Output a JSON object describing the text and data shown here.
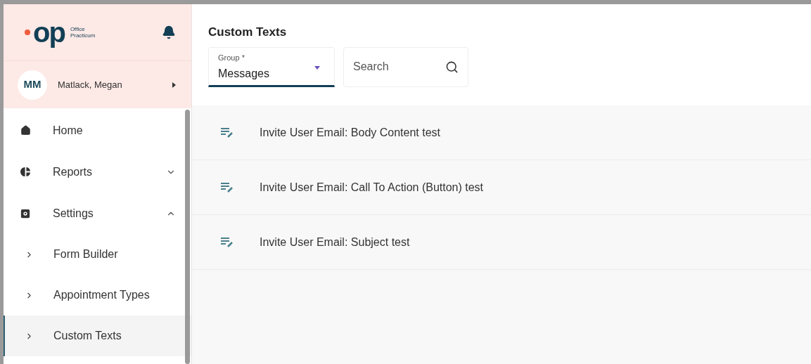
{
  "logo": {
    "mark": "op",
    "line1": "Office",
    "line2": "Practicum"
  },
  "user": {
    "initials": "MM",
    "name": "Matlack, Megan"
  },
  "nav": [
    {
      "label": "Home",
      "kind": "home",
      "selected": false
    },
    {
      "label": "Reports",
      "kind": "chart",
      "expanded": false,
      "selected": false
    },
    {
      "label": "Settings",
      "kind": "gear",
      "expanded": true,
      "selected": false,
      "children": [
        {
          "label": "Form Builder",
          "selected": false
        },
        {
          "label": "Appointment Types",
          "selected": false
        },
        {
          "label": "Custom Texts",
          "selected": true
        }
      ]
    }
  ],
  "page": {
    "title": "Custom Texts"
  },
  "group_select": {
    "label": "Group *",
    "value": "Messages"
  },
  "search": {
    "placeholder": "Search"
  },
  "items": [
    {
      "label": "Invite User Email: Body Content test"
    },
    {
      "label": "Invite User Email: Call To Action (Button) test"
    },
    {
      "label": "Invite User Email: Subject test"
    }
  ]
}
